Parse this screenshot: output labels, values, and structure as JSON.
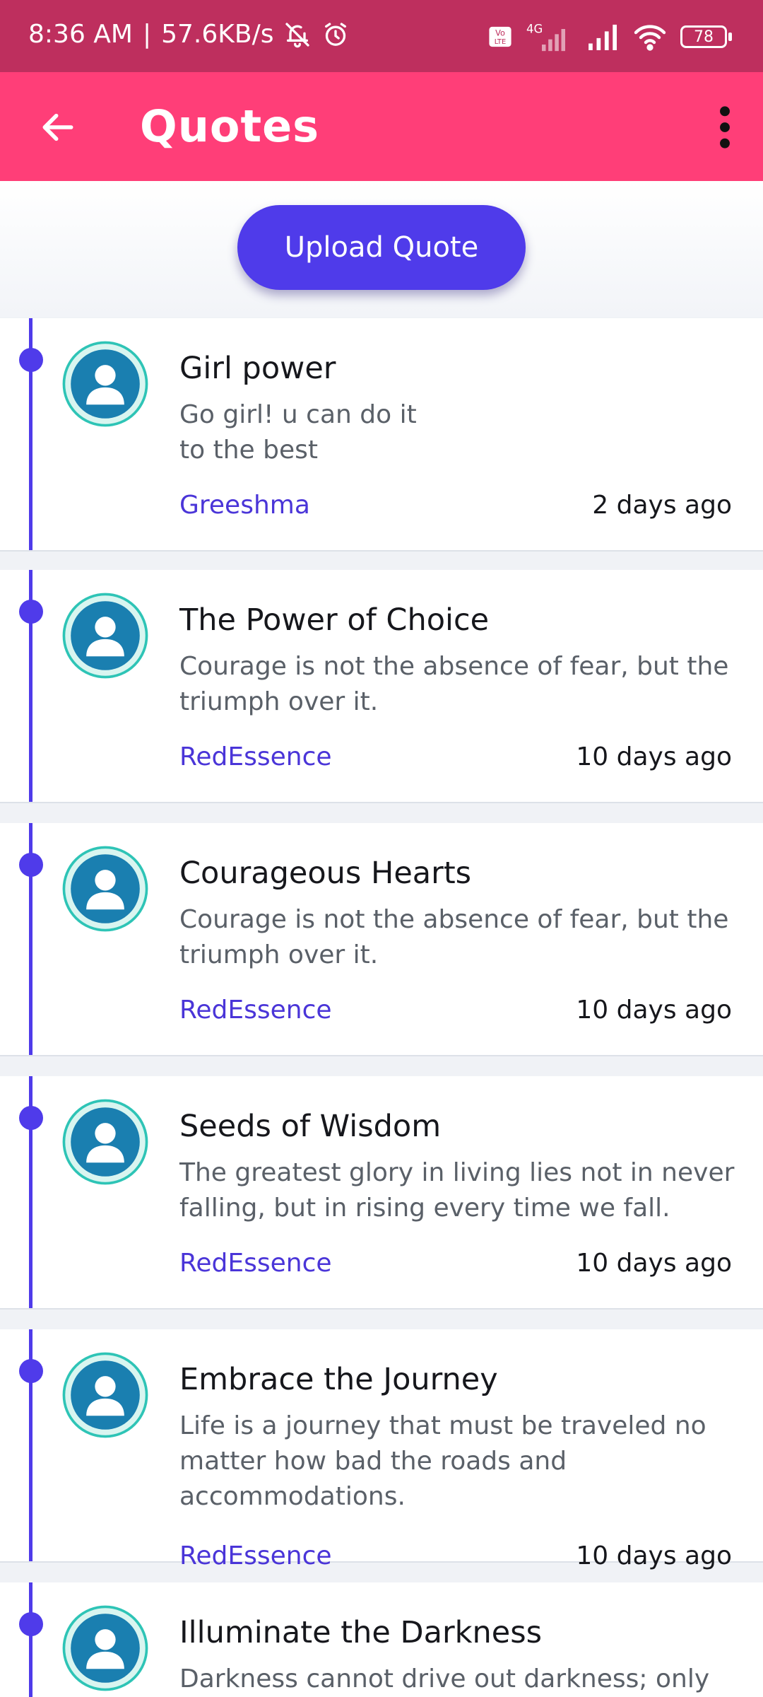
{
  "status_bar": {
    "time": "8:36 AM",
    "speed": "57.6KB/s",
    "separator": "|",
    "network_label": "4G",
    "volte_label": "Vo LTE",
    "battery": "78",
    "icons": [
      "notifications-off-icon",
      "alarm-icon",
      "volte-icon",
      "signal-4g-icon",
      "signal-icon",
      "wifi-icon",
      "battery-icon"
    ]
  },
  "app_bar": {
    "title": "Quotes",
    "icons": [
      "back-arrow-icon",
      "more-vert-icon"
    ]
  },
  "upload_button": "Upload Quote",
  "colors": {
    "status_bar": "#be2f5e",
    "app_bar": "#ff3e78",
    "accent": "#4f3bea",
    "avatar_ring": "#2ec4b6",
    "avatar_fill": "#1a7fb0"
  },
  "quotes": [
    {
      "title": "Girl power",
      "lines": [
        "Go girl! u can do it",
        "to the best"
      ],
      "author": "Greeshma",
      "time": "2 days ago"
    },
    {
      "title": "The Power of Choice",
      "lines": [
        "Courage is not the absence of fear, but the",
        "triumph over it."
      ],
      "author": "RedEssence",
      "time": "10 days ago"
    },
    {
      "title": "Courageous Hearts",
      "lines": [
        "Courage is not the absence of fear, but the",
        "triumph over it."
      ],
      "author": "RedEssence",
      "time": "10 days ago"
    },
    {
      "title": "Seeds of Wisdom",
      "lines": [
        "The greatest glory in living lies not in never",
        "falling, but in rising every time we fall."
      ],
      "author": "RedEssence",
      "time": "10 days ago"
    },
    {
      "title": "Embrace the Journey",
      "lines": [
        "Life is a journey that must be traveled no",
        "matter how bad the roads and",
        "accommodations."
      ],
      "author": "RedEssence",
      "time": "10 days ago"
    },
    {
      "title": "Illuminate the Darkness",
      "lines": [
        "Darkness cannot drive out darkness; only"
      ],
      "author": "",
      "time": ""
    }
  ]
}
